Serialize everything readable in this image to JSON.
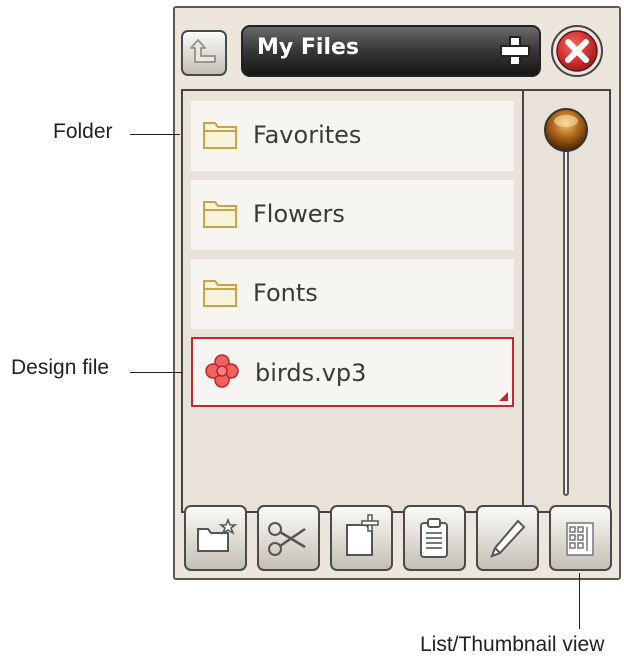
{
  "header": {
    "title": "My Files"
  },
  "files": [
    {
      "name": "Favorites",
      "type": "folder"
    },
    {
      "name": "Flowers",
      "type": "folder"
    },
    {
      "name": "Fonts",
      "type": "folder"
    },
    {
      "name": "birds.vp3",
      "type": "design"
    }
  ],
  "toolbar": [
    {
      "icon": "new-folder-icon"
    },
    {
      "icon": "scissors-icon"
    },
    {
      "icon": "new-file-icon"
    },
    {
      "icon": "clipboard-icon"
    },
    {
      "icon": "pencil-icon"
    },
    {
      "icon": "list-thumbnail-icon"
    }
  ],
  "annotations": {
    "folder": "Folder",
    "design_file": "Design file",
    "view": "List/Thumbnail view"
  },
  "colors": {
    "selection": "#c0282f",
    "folder": "#d6b45a",
    "close": "#d03535"
  }
}
